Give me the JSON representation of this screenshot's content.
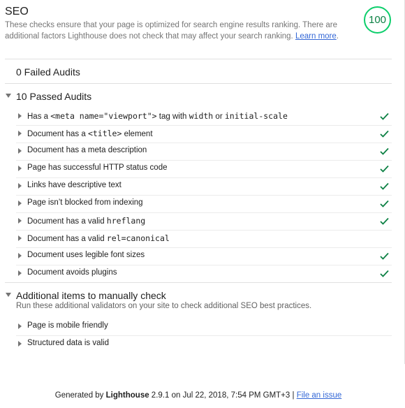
{
  "category": {
    "title": "SEO",
    "description": "These checks ensure that your page is optimized for search engine results ranking. There are additional factors Lighthouse does not check that may affect your search ranking.",
    "learn_more": "Learn more",
    "score": "100",
    "score_color": "#0cce6b"
  },
  "failed": {
    "title": "0 Failed Audits"
  },
  "passed": {
    "title": "10 Passed Audits",
    "audits": [
      {
        "parts": [
          "Has a ",
          "<meta name=\"viewport\">",
          " tag with ",
          "width",
          " or ",
          "initial-scale"
        ],
        "pass": true
      },
      {
        "parts": [
          "Document has a ",
          "<title>",
          " element"
        ],
        "pass": true
      },
      {
        "parts": [
          "Document has a meta description"
        ],
        "pass": true
      },
      {
        "parts": [
          "Page has successful HTTP status code"
        ],
        "pass": true
      },
      {
        "parts": [
          "Links have descriptive text"
        ],
        "pass": true
      },
      {
        "parts": [
          "Page isn’t blocked from indexing"
        ],
        "pass": true
      },
      {
        "parts": [
          "Document has a valid ",
          "hreflang"
        ],
        "pass": true
      },
      {
        "parts": [
          "Document has a valid ",
          "rel=canonical"
        ],
        "pass": false
      },
      {
        "parts": [
          "Document uses legible font sizes"
        ],
        "pass": true
      },
      {
        "parts": [
          "Document avoids plugins"
        ],
        "pass": true
      }
    ]
  },
  "manual": {
    "title": "Additional items to manually check",
    "description": "Run these additional validators on your site to check additional SEO best practices.",
    "audits": [
      {
        "parts": [
          "Page is mobile friendly"
        ]
      },
      {
        "parts": [
          "Structured data is valid"
        ]
      }
    ]
  },
  "footer": {
    "prefix": "Generated by ",
    "brand": "Lighthouse",
    "middle": " 2.9.1 on Jul 22, 2018, 7:54 PM GMT+3 | ",
    "issue_link": "File an issue"
  },
  "colors": {
    "pass": "#0b8043",
    "link": "#3367d6"
  }
}
